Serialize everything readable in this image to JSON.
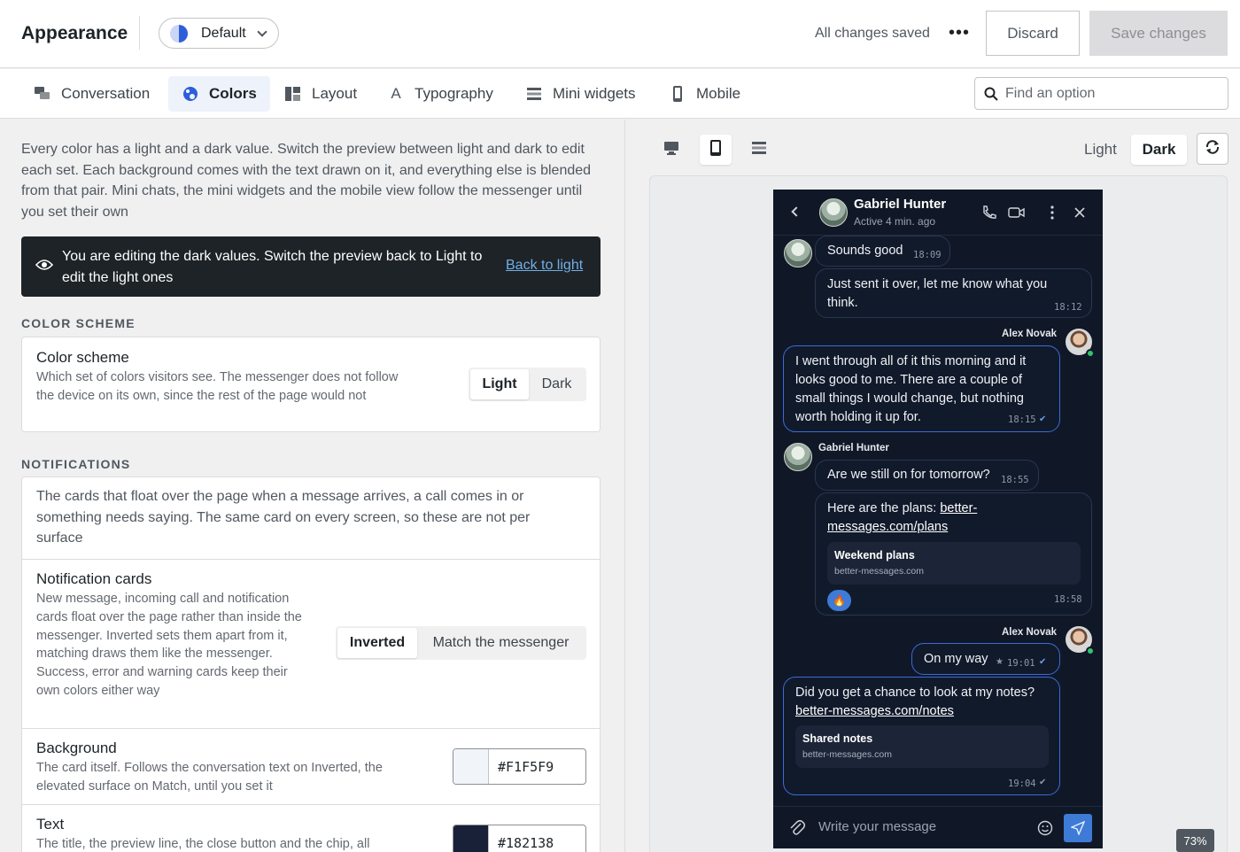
{
  "header": {
    "title": "Appearance",
    "preset_label": "Default",
    "status": "All changes saved",
    "more_label": "•••",
    "discard_label": "Discard",
    "save_label": "Save changes"
  },
  "tabs": [
    {
      "label": "Conversation",
      "icon": "chat-bubbles-icon"
    },
    {
      "label": "Colors",
      "icon": "palette-icon",
      "active": true
    },
    {
      "label": "Layout",
      "icon": "layout-icon"
    },
    {
      "label": "Typography",
      "icon": "typography-icon"
    },
    {
      "label": "Mini widgets",
      "icon": "list-icon"
    },
    {
      "label": "Mobile",
      "icon": "mobile-icon"
    }
  ],
  "search": {
    "placeholder": "Find an option",
    "value": ""
  },
  "intro": "Every color has a light and a dark value. Switch the preview between light and dark to edit each set. Each background comes with the text drawn on it, and everything else is blended from that pair. Mini chats, the mini widgets and the mobile view follow the messenger until you set their own",
  "banner": {
    "text": "You are editing the dark values. Switch the preview back to Light to edit the light ones",
    "link": "Back to light"
  },
  "sections": {
    "color_scheme": {
      "label": "COLOR SCHEME",
      "row": {
        "title": "Color scheme",
        "desc": "Which set of colors visitors see. The messenger does not follow the device on its own, since the rest of the page would not",
        "options": [
          "Light",
          "Dark"
        ],
        "selected": "Light"
      }
    },
    "notifications": {
      "label": "NOTIFICATIONS",
      "intro": "The cards that float over the page when a message arrives, a call comes in or something needs saying. The same card on every screen, so these are not per surface",
      "cards": {
        "title": "Notification cards",
        "desc": "New message, incoming call and notification cards float over the page rather than inside the messenger. Inverted sets them apart from it, matching draws them like the messenger. Success, error and warning cards keep their own colors either way",
        "options": [
          "Inverted",
          "Match the messenger"
        ],
        "selected": "Inverted"
      },
      "background": {
        "title": "Background",
        "desc": "The card itself. Follows the conversation text on Inverted, the elevated surface on Match, until you set it",
        "value": "#F1F5F9"
      },
      "text": {
        "title": "Text",
        "desc": "The title, the preview line, the close button and the chip, all",
        "value": "#182138"
      }
    }
  },
  "preview": {
    "mode_light": "Light",
    "mode_dark": "Dark",
    "zoom": "73%",
    "messenger": {
      "name": "Gabriel Hunter",
      "status": "Active 4 min. ago",
      "messages": [
        {
          "text": "Sounds good",
          "time": "18:09"
        },
        {
          "text": "Just sent it over, let me know what you think.",
          "time": "18:12"
        },
        {
          "author": "Alex Novak",
          "text": "I went through all of it this morning and it looks good to me. There are a couple of small things I would change, but nothing worth holding it up for.",
          "time": "18:15"
        },
        {
          "author": "Gabriel Hunter",
          "text": "Are we still on for tomorrow?",
          "time": "18:55"
        },
        {
          "text_prefix": "Here are the plans: ",
          "link": "better-messages.com/plans",
          "preview_title": "Weekend plans",
          "preview_domain": "better-messages.com",
          "reaction": "🔥",
          "time": "18:58"
        },
        {
          "author": "Alex Novak",
          "text": "On my way",
          "time": "19:01"
        },
        {
          "text": "Did you get a chance to look at my notes?",
          "link": "better-messages.com/notes",
          "preview_title": "Shared notes",
          "preview_domain": "better-messages.com",
          "time": "19:04"
        }
      ],
      "composer_placeholder": "Write your message"
    }
  }
}
